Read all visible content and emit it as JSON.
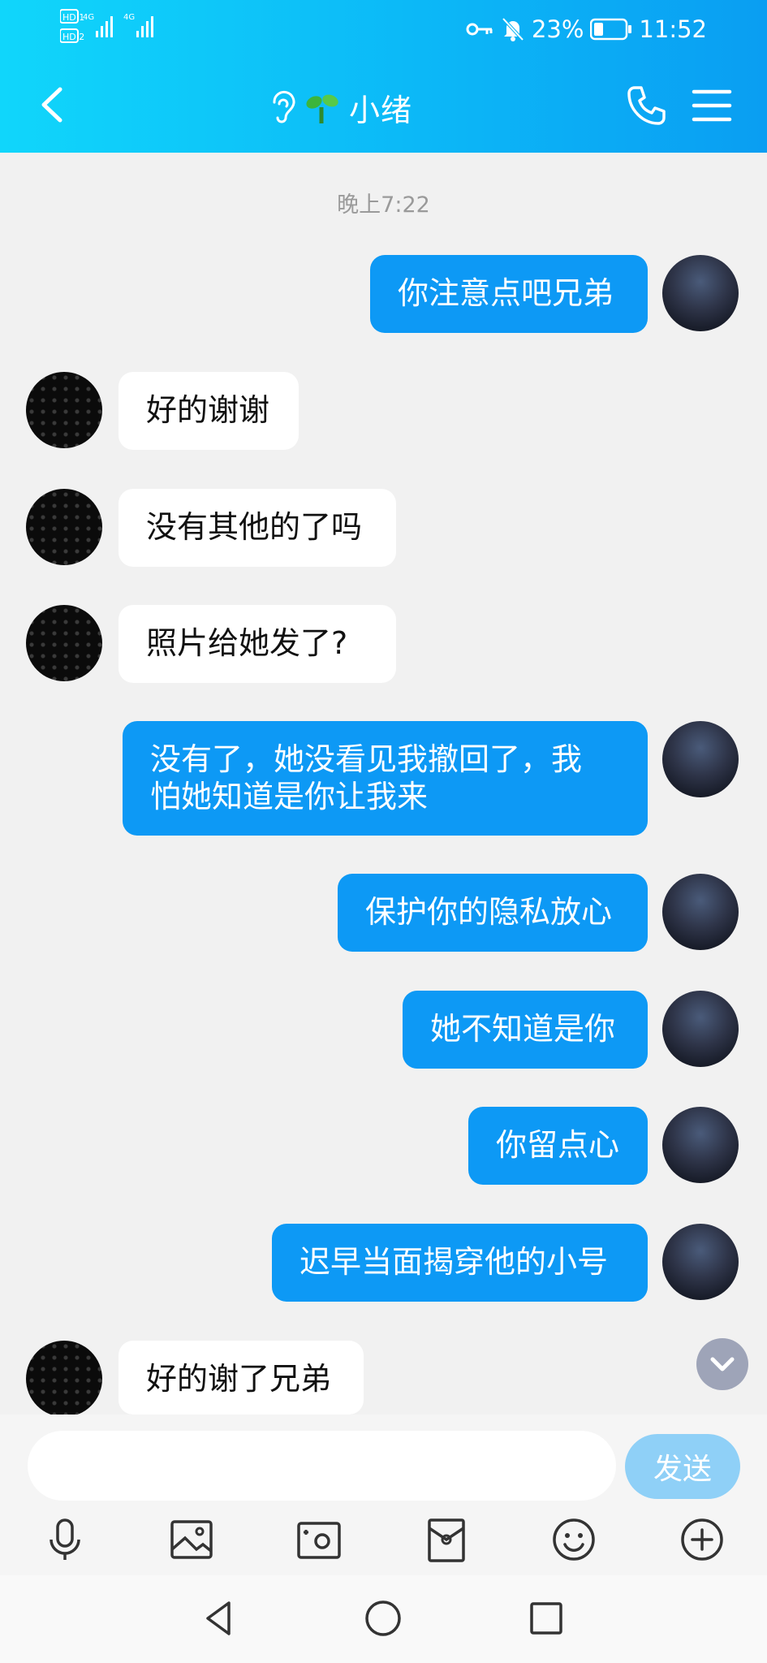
{
  "status_bar": {
    "sim1": "HD 1",
    "sim2": "HD 2",
    "network1": "4G",
    "network2": "4G",
    "battery": "23%",
    "time": "11:52"
  },
  "header": {
    "title": "小绪",
    "back_icon": "chevron-left-icon",
    "ear_icon": "ear-icon",
    "sprout_icon": "sprout-icon",
    "phone_icon": "phone-icon",
    "menu_icon": "menu-icon",
    "bg_color_start": "#10d6fb",
    "bg_color_end": "#0a9ef2"
  },
  "chat": {
    "timestamp": "晚上7:22",
    "messages": [
      {
        "from": "me",
        "lines": [
          "你注意点吧兄弟"
        ]
      },
      {
        "from": "other",
        "lines": [
          "好的谢谢"
        ]
      },
      {
        "from": "other",
        "lines": [
          "没有其他的了吗"
        ]
      },
      {
        "from": "other",
        "lines": [
          "照片给她发了?"
        ]
      },
      {
        "from": "me",
        "lines": [
          "没有了，她没看见我撤回了，我",
          "怕她知道是你让我来"
        ]
      },
      {
        "from": "me",
        "lines": [
          "保护你的隐私放心"
        ]
      },
      {
        "from": "me",
        "lines": [
          "她不知道是你"
        ]
      },
      {
        "from": "me",
        "lines": [
          "你留点心"
        ]
      },
      {
        "from": "me",
        "lines": [
          "迟早当面揭穿他的小号"
        ]
      },
      {
        "from": "other",
        "lines": [
          "好的谢了兄弟"
        ]
      }
    ],
    "my_bubble_color": "#0d99f5",
    "other_bubble_color": "#ffffff"
  },
  "input": {
    "value": "",
    "placeholder": "",
    "send_label": "发送"
  },
  "toolbar": [
    "microphone-icon",
    "image-icon",
    "camera-icon",
    "red-packet-icon",
    "emoji-icon",
    "plus-icon"
  ],
  "system_nav": [
    "back-triangle-icon",
    "home-circle-icon",
    "recents-square-icon"
  ]
}
